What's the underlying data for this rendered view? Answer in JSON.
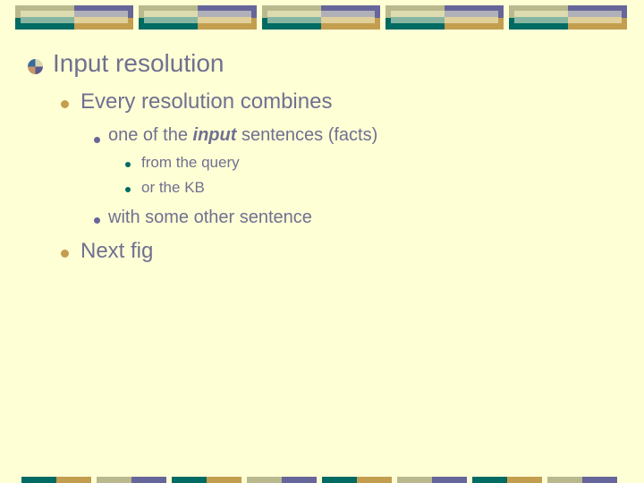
{
  "slide": {
    "title": "Input resolution",
    "bullets": [
      {
        "level": 2,
        "text": "Every resolution combines"
      },
      {
        "level": 3,
        "text_before": "one of the ",
        "text_emphasis": "input",
        "text_after": " sentences (facts)"
      },
      {
        "level": 4,
        "text": "from the query"
      },
      {
        "level": 4,
        "text": "or the KB"
      },
      {
        "level": 3,
        "text": "with some other sentence"
      },
      {
        "level": 2,
        "text": "Next fig"
      }
    ]
  },
  "theme": {
    "background": "#ffffd6",
    "text_color": "#707090",
    "colors": {
      "olive": "#b9b98d",
      "teal": "#006b63",
      "purple": "#66669a",
      "gold": "#c29e4e"
    },
    "icons": {
      "title_bullet": "quartered-pie-icon",
      "level2_bullet": "gold-dot-icon",
      "level3_bullet": "purple-dot-icon",
      "level4_bullet": "teal-dot-icon"
    }
  }
}
